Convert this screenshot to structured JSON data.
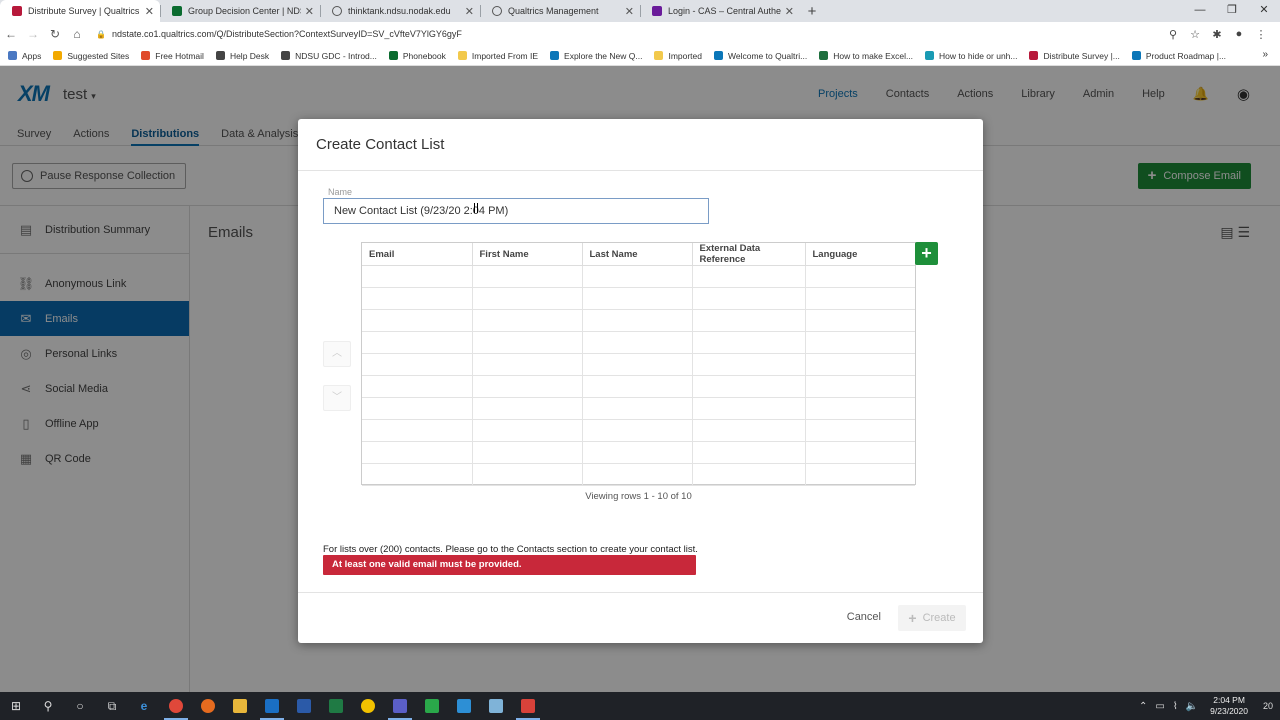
{
  "browser": {
    "tabs": [
      {
        "title": "Distribute Survey | Qualtrics Surv",
        "color": "#b7193b",
        "active": true
      },
      {
        "title": "Group Decision Center | NDSU",
        "color": "#0a6b2f",
        "active": false
      },
      {
        "title": "thinktank.ndsu.nodak.edu",
        "color": "#555555",
        "active": false
      },
      {
        "title": "Qualtrics Management",
        "color": "#555555",
        "active": false
      },
      {
        "title": "Login - CAS – Central Authenticat",
        "color": "#6a1b9a",
        "active": false
      }
    ],
    "url": "ndstate.co1.qualtrics.com/Q/DistributeSection?ContextSurveyID=SV_cVfteV7YlGY6gyF",
    "bookmarks": [
      {
        "label": "Apps",
        "color": "#4a78c2"
      },
      {
        "label": "Suggested Sites",
        "color": "#f2a900"
      },
      {
        "label": "Free Hotmail",
        "color": "#e04a2b"
      },
      {
        "label": "Help Desk",
        "color": "#444444"
      },
      {
        "label": "NDSU GDC - Introd...",
        "color": "#444444"
      },
      {
        "label": "Phonebook",
        "color": "#0a6b2f"
      },
      {
        "label": "Imported From IE",
        "color": "#f2c94c"
      },
      {
        "label": "Explore the New Q...",
        "color": "#0b76b8"
      },
      {
        "label": "Imported",
        "color": "#f2c94c"
      },
      {
        "label": "Welcome to Qualtri...",
        "color": "#0b76b8"
      },
      {
        "label": "How to make Excel...",
        "color": "#1e6f3e"
      },
      {
        "label": "How to hide or unh...",
        "color": "#1a9bb4"
      },
      {
        "label": "Distribute Survey |...",
        "color": "#b7193b"
      },
      {
        "label": "Product Roadmap |...",
        "color": "#0b76b8"
      }
    ]
  },
  "app": {
    "logo": "XM",
    "project": "test",
    "topnav": [
      "Projects",
      "Contacts",
      "Actions",
      "Library",
      "Admin",
      "Help"
    ],
    "subnav": [
      "Survey",
      "Actions",
      "Distributions",
      "Data & Analysis"
    ],
    "pause_label": "Pause Response Collection",
    "compose_label": "Compose Email",
    "sidebar": [
      {
        "label": "Distribution Summary",
        "icon": "▤"
      },
      {
        "label": "Anonymous Link",
        "icon": "⛓"
      },
      {
        "label": "Emails",
        "icon": "✉"
      },
      {
        "label": "Personal Links",
        "icon": "◎"
      },
      {
        "label": "Social Media",
        "icon": "⋖"
      },
      {
        "label": "Offline App",
        "icon": "▯"
      },
      {
        "label": "QR Code",
        "icon": "▦"
      }
    ],
    "main_title": "Emails"
  },
  "modal": {
    "title": "Create Contact List",
    "name_label": "Name",
    "name_value": "New Contact List (9/23/20 2:04 PM)",
    "columns": [
      "Email",
      "First Name",
      "Last Name",
      "External Data Reference",
      "Language"
    ],
    "row_status": "Viewing rows 1 - 10 of 10",
    "limit_note": "For lists over (200) contacts. Please go to the Contacts section to create your contact list.",
    "error": "At least one valid email must be provided.",
    "cancel": "Cancel",
    "create": "Create"
  },
  "taskbar": {
    "time": "2:04 PM",
    "date": "9/23/2020",
    "notifications": "20"
  }
}
